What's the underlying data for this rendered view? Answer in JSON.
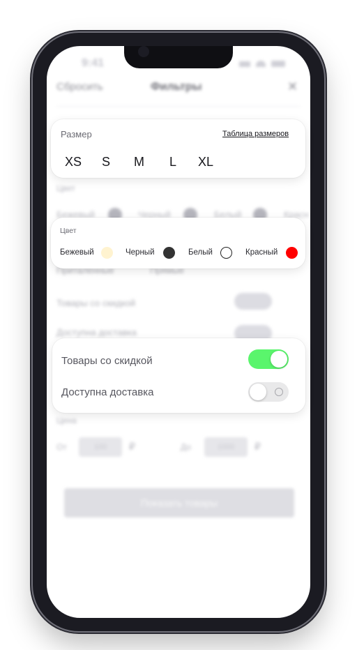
{
  "status_bar": {
    "time": "9:41"
  },
  "header": {
    "reset": "Сбросить",
    "title": "Фильтры",
    "close_symbol": "✕"
  },
  "background": {
    "color_title": "Цвет",
    "colors_partial": [
      "Бежевый",
      "Черный",
      "Белый",
      "Красн"
    ],
    "cuts": [
      "Приталенные",
      "Прямые"
    ],
    "discount": "Товары со скидкой",
    "delivery": "Доступна доставка",
    "price_title": "Цена",
    "price_from_label": "От",
    "price_from_value": "100",
    "price_to_label": "До",
    "price_to_value": "1000",
    "currency": "₽",
    "show_button": "Показать товары"
  },
  "size_card": {
    "title": "Размер",
    "table_link": "Таблица размеров",
    "sizes": [
      "XS",
      "S",
      "M",
      "L",
      "XL"
    ]
  },
  "color_card": {
    "title": "Цвет",
    "colors": [
      {
        "label": "Бежевый",
        "hex": "#fff3d0"
      },
      {
        "label": "Черный",
        "hex": "#333333"
      },
      {
        "label": "Белый",
        "hex": "#ffffff"
      },
      {
        "label": "Красный",
        "hex": "#ff0000"
      }
    ]
  },
  "toggle_card": {
    "discount_label": "Товары со скидкой",
    "discount_on": true,
    "delivery_label": "Доступна доставка",
    "delivery_on": false,
    "on_color": "#5af56c"
  }
}
